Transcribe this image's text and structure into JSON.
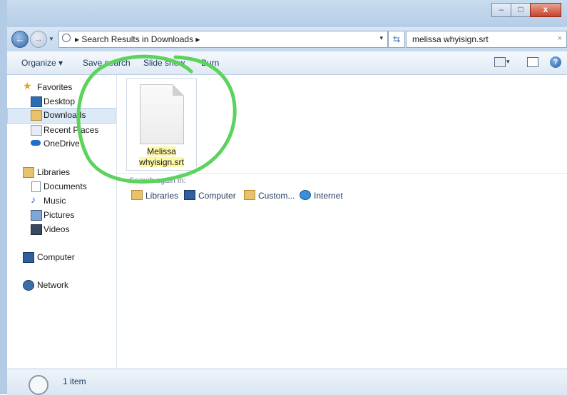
{
  "window": {
    "minimize_glyph": "–",
    "maximize_glyph": "□",
    "close_glyph": "x"
  },
  "address": {
    "breadcrumb": "▸ Search Results in Downloads ▸",
    "dropdown_glyph": "▾",
    "refresh_glyph": "⇆",
    "search_value": "melissa whyisign.srt",
    "search_clear": "×"
  },
  "toolbar": {
    "organize": "Organize ▾",
    "save_search": "Save search",
    "slide_show": "Slide show",
    "burn": "Burn",
    "view_dropdown": "▾",
    "help": "?"
  },
  "nav": {
    "favorites": "Favorites",
    "desktop": "Desktop",
    "downloads": "Downloads",
    "recent_places": "Recent Places",
    "onedrive": "OneDrive",
    "libraries": "Libraries",
    "documents": "Documents",
    "music": "Music",
    "pictures": "Pictures",
    "videos": "Videos",
    "computer": "Computer",
    "network": "Network"
  },
  "file": {
    "name_line1": "Melissa",
    "name_line2": "whyisign.srt"
  },
  "search_again": {
    "label": "Search again in:",
    "links": [
      "Libraries",
      "Computer",
      "Custom...",
      "Internet"
    ]
  },
  "status": {
    "count": "1 item"
  },
  "colors": {
    "annotation": "#5cd35c",
    "accent": "#1e395b"
  }
}
